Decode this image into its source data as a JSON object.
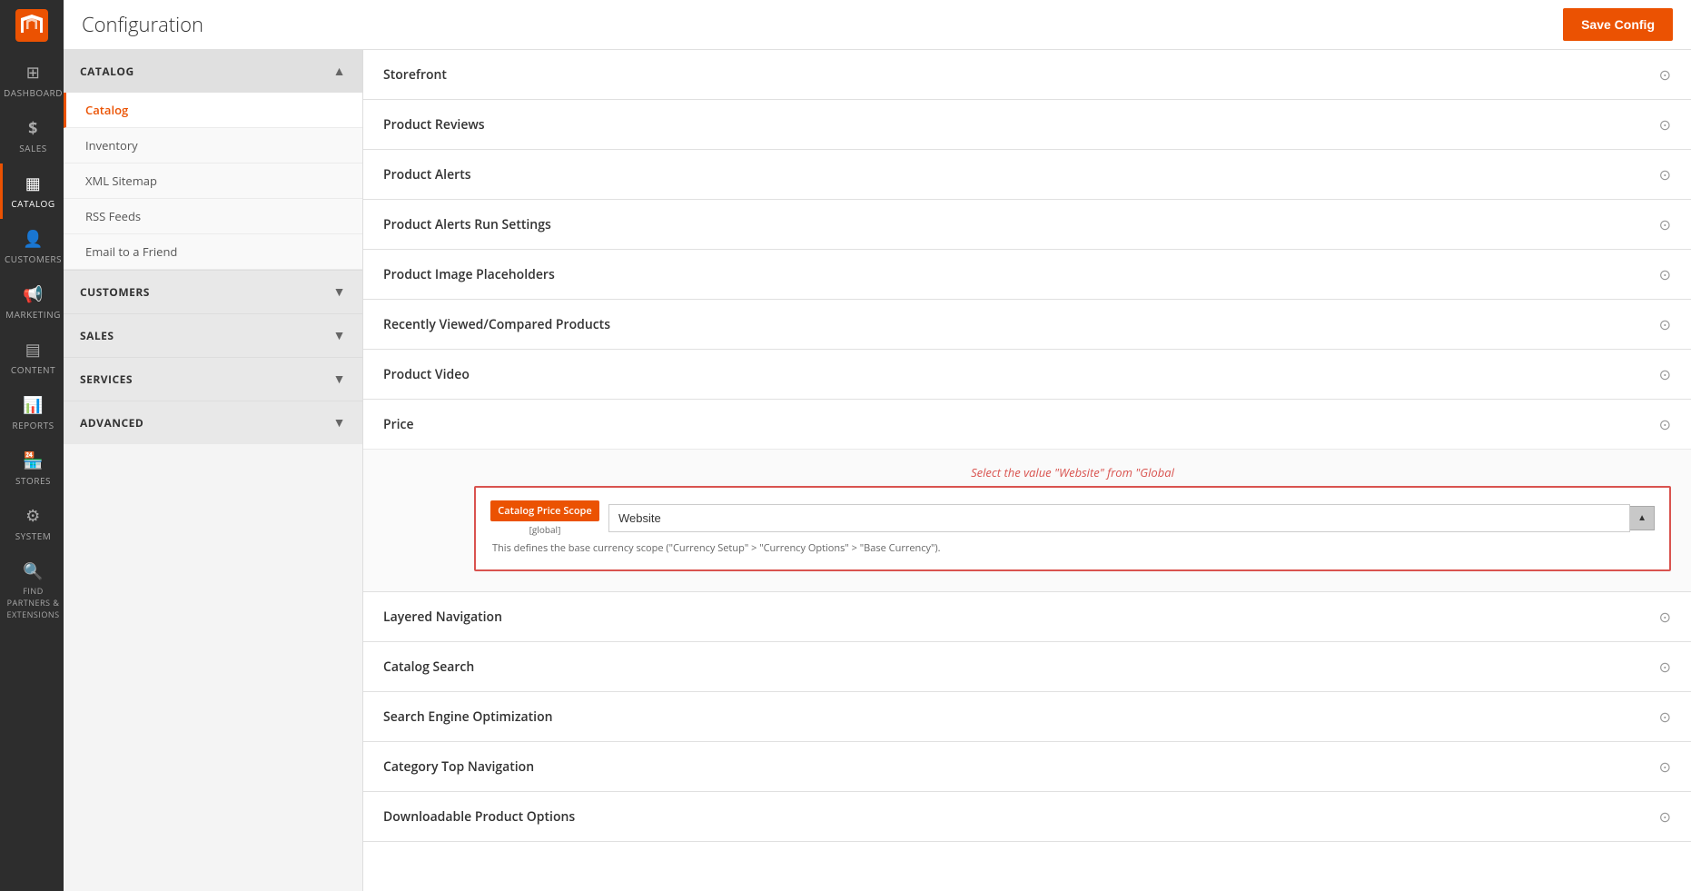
{
  "page": {
    "title": "Configuration",
    "save_button": "Save Config"
  },
  "left_nav": {
    "items": [
      {
        "id": "dashboard",
        "label": "DASHBOARD",
        "icon": "⊞"
      },
      {
        "id": "sales",
        "label": "SALES",
        "icon": "$"
      },
      {
        "id": "catalog",
        "label": "CATALOG",
        "icon": "◫",
        "active": true
      },
      {
        "id": "customers",
        "label": "CUSTOMERS",
        "icon": "👤"
      },
      {
        "id": "marketing",
        "label": "MARKETING",
        "icon": "📢"
      },
      {
        "id": "content",
        "label": "CONTENT",
        "icon": "▤"
      },
      {
        "id": "reports",
        "label": "REPORTS",
        "icon": "📊"
      },
      {
        "id": "stores",
        "label": "STORES",
        "icon": "🏪"
      },
      {
        "id": "system",
        "label": "SYSTEM",
        "icon": "⚙"
      },
      {
        "id": "find-partners",
        "label": "FIND PARTNERS & EXTENSIONS",
        "icon": "🔍"
      }
    ]
  },
  "sidebar": {
    "sections": [
      {
        "id": "catalog",
        "label": "CATALOG",
        "expanded": true,
        "links": [
          {
            "id": "catalog-link",
            "label": "Catalog",
            "active": true
          },
          {
            "id": "inventory-link",
            "label": "Inventory"
          },
          {
            "id": "xml-sitemap-link",
            "label": "XML Sitemap"
          },
          {
            "id": "rss-feeds-link",
            "label": "RSS Feeds"
          },
          {
            "id": "email-friend-link",
            "label": "Email to a Friend"
          }
        ]
      },
      {
        "id": "customers",
        "label": "CUSTOMERS",
        "expanded": false,
        "links": []
      },
      {
        "id": "sales",
        "label": "SALES",
        "expanded": false,
        "links": []
      },
      {
        "id": "services",
        "label": "SERVICES",
        "expanded": false,
        "links": []
      },
      {
        "id": "advanced",
        "label": "ADVANCED",
        "expanded": false,
        "links": []
      }
    ]
  },
  "main": {
    "sections": [
      {
        "id": "storefront",
        "label": "Storefront",
        "expanded": false
      },
      {
        "id": "product-reviews",
        "label": "Product Reviews",
        "expanded": false
      },
      {
        "id": "product-alerts",
        "label": "Product Alerts",
        "expanded": false
      },
      {
        "id": "product-alerts-run",
        "label": "Product Alerts Run Settings",
        "expanded": false
      },
      {
        "id": "product-image",
        "label": "Product Image Placeholders",
        "expanded": false
      },
      {
        "id": "recently-viewed",
        "label": "Recently Viewed/Compared Products",
        "expanded": false
      },
      {
        "id": "product-video",
        "label": "Product Video",
        "expanded": false
      }
    ],
    "price_section": {
      "label": "Price",
      "annotation": "Select the value \"Website\" from  \"Global",
      "field_label": "Catalog Price Scope",
      "field_sub": "[global]",
      "field_value": "Website",
      "field_hint": "This defines the base currency scope (\"Currency Setup\" > \"Currency Options\" > \"Base Currency\")."
    },
    "sections_below": [
      {
        "id": "layered-nav",
        "label": "Layered Navigation",
        "expanded": false
      },
      {
        "id": "catalog-search",
        "label": "Catalog Search",
        "expanded": false
      },
      {
        "id": "seo",
        "label": "Search Engine Optimization",
        "expanded": false
      },
      {
        "id": "category-nav",
        "label": "Category Top Navigation",
        "expanded": false
      },
      {
        "id": "downloadable",
        "label": "Downloadable Product Options",
        "expanded": false
      }
    ]
  }
}
